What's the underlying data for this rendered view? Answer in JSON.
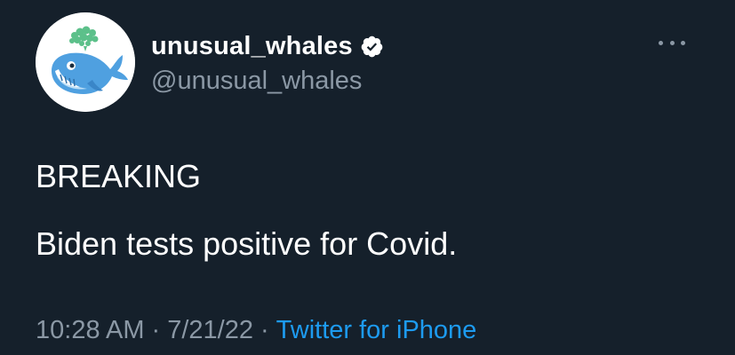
{
  "author": {
    "display_name": "unusual_whales",
    "handle": "@unusual_whales",
    "verified": true,
    "avatar_icon": "whale-avatar-icon"
  },
  "tweet": {
    "lines": [
      "BREAKING",
      "Biden tests positive for Covid."
    ]
  },
  "meta": {
    "time": "10:28 AM",
    "date": "7/21/22",
    "separator": "·",
    "source": "Twitter for iPhone"
  },
  "colors": {
    "background": "#15202b",
    "text_primary": "#ffffff",
    "text_secondary": "#8b98a5",
    "link": "#1d9bf0",
    "whale_blue": "#4fa0e0",
    "spray_green": "#6fcf97"
  }
}
